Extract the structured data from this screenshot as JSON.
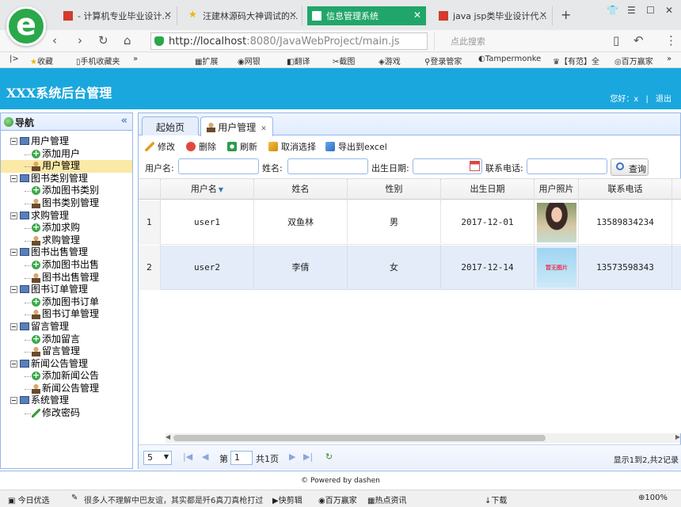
{
  "browser": {
    "tabs": [
      {
        "title": "- 计算机专业毕业设计...",
        "fav_color": "#d33b2c"
      },
      {
        "title": "汪建林源码大神调试的...",
        "fav_color": "#f0b400"
      },
      {
        "title": "信息管理系统",
        "fav_color": "#ffffff"
      },
      {
        "title": "java jsp类毕业设计代...",
        "fav_color": "#d33b2c"
      }
    ],
    "url_host": "http://localhost",
    "url_path": ":8080/JavaWebProject/main.js",
    "search_placeholder": "点此搜索",
    "bookmarks": [
      "收藏",
      "手机收藏夹",
      "»",
      "扩展",
      "网银",
      "翻译",
      "截图",
      "游戏",
      "登录管家",
      "Tampermonke",
      "【有范】全",
      "百万赢家",
      "»"
    ]
  },
  "app": {
    "title": "XXX系统后台管理",
    "welcome": "您好：x",
    "logout": "退出"
  },
  "nav": {
    "title": "导航",
    "items": [
      {
        "label": "用户管理",
        "type": "group"
      },
      {
        "label": "添加用户",
        "type": "add"
      },
      {
        "label": "用户管理",
        "type": "user",
        "selected": true
      },
      {
        "label": "图书类别管理",
        "type": "group"
      },
      {
        "label": "添加图书类别",
        "type": "add"
      },
      {
        "label": "图书类别管理",
        "type": "user"
      },
      {
        "label": "求购管理",
        "type": "group"
      },
      {
        "label": "添加求购",
        "type": "add"
      },
      {
        "label": "求购管理",
        "type": "user"
      },
      {
        "label": "图书出售管理",
        "type": "group"
      },
      {
        "label": "添加图书出售",
        "type": "add"
      },
      {
        "label": "图书出售管理",
        "type": "user"
      },
      {
        "label": "图书订单管理",
        "type": "group"
      },
      {
        "label": "添加图书订单",
        "type": "add"
      },
      {
        "label": "图书订单管理",
        "type": "user"
      },
      {
        "label": "留言管理",
        "type": "group"
      },
      {
        "label": "添加留言",
        "type": "add"
      },
      {
        "label": "留言管理",
        "type": "user"
      },
      {
        "label": "新闻公告管理",
        "type": "group"
      },
      {
        "label": "添加新闻公告",
        "type": "add"
      },
      {
        "label": "新闻公告管理",
        "type": "user"
      },
      {
        "label": "系统管理",
        "type": "group"
      },
      {
        "label": "修改密码",
        "type": "pencil"
      }
    ]
  },
  "tabs": {
    "home": "起始页",
    "current": "用户管理"
  },
  "toolbar": {
    "edit": "修改",
    "delete": "删除",
    "refresh": "刷新",
    "cancel_select": "取消选择",
    "export": "导出到excel"
  },
  "search": {
    "username_label": "用户名:",
    "name_label": "姓名:",
    "birth_label": "出生日期:",
    "phone_label": "联系电话:",
    "query": "查询"
  },
  "grid": {
    "columns": [
      "用户名",
      "姓名",
      "性别",
      "出生日期",
      "用户照片",
      "联系电话"
    ],
    "rows": [
      {
        "num": "1",
        "username": "user1",
        "name": "双鱼林",
        "gender": "男",
        "birth": "2017-12-01",
        "phone": "13589834234"
      },
      {
        "num": "2",
        "username": "user2",
        "name": "李倩",
        "gender": "女",
        "birth": "2017-12-14",
        "phone": "13573598343",
        "photo_text": "暂无图片"
      }
    ]
  },
  "pager": {
    "page_size": "5",
    "page_prefix": "第",
    "page_value": "1",
    "page_suffix": "共1页",
    "info": "显示1到2,共2记录"
  },
  "footer": "© Powered by dashen",
  "status": {
    "left": "今日优选",
    "news": "很多人不理解中巴友谊，其实都是歼6真刀真枪打过",
    "items": [
      "快剪辑",
      "百万赢家",
      "热点资讯",
      "下载",
      "100%"
    ]
  }
}
